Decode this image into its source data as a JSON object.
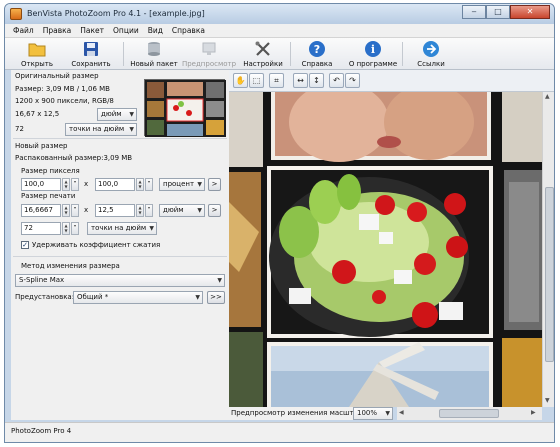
{
  "window": {
    "title": "BenVista PhotoZoom Pro 4.1 - [example.jpg]"
  },
  "menu": [
    "Файл",
    "Правка",
    "Пакет",
    "Опции",
    "Вид",
    "Справка"
  ],
  "toolbar": {
    "open": "Открыть",
    "save": "Сохранить",
    "new_batch": "Новый пакет",
    "preview": "Предпросмотр",
    "settings": "Настройки",
    "help": "Справка",
    "about": "О программе",
    "links": "Ссылки"
  },
  "original": {
    "header": "Оригинальный размер",
    "size": "Размер: 3,09 MB / 1,06 MB",
    "pixels": "1200 x 900 пиксели, RGB/8",
    "width_value": "16,67 x 12,5",
    "unit": "дюйм",
    "res_value": "72",
    "res_unit": "точки на дюйм"
  },
  "new_size": {
    "header": "Новый размер",
    "unpacked": "Распакованный размер:3,09 MB",
    "pixel_header": "Размер пикселя",
    "px_w": "100,0",
    "px_h": "100,0",
    "px_unit": "процент",
    "print_header": "Размер печати",
    "pr_w": "16,6667",
    "pr_h": "12,5",
    "pr_unit": "дюйм",
    "pr_res": "72",
    "pr_res_unit": "точки на дюйм",
    "keep_ratio": "Удерживать коэффициент сжатия",
    "times": "x",
    "more": ">"
  },
  "method": {
    "header": "Метод изменения размера",
    "algorithm": "S-Spline Max",
    "preset_label": "Предустановка:",
    "preset_value": "Общий *",
    "more": ">>"
  },
  "zoom": {
    "label": "Предпросмотр изменения масштаба:",
    "value": "100%"
  },
  "status": {
    "text": "PhotoZoom Pro 4"
  },
  "colors": {
    "accent": "#2a6fc9",
    "title_bg": "#c6d6e8"
  }
}
